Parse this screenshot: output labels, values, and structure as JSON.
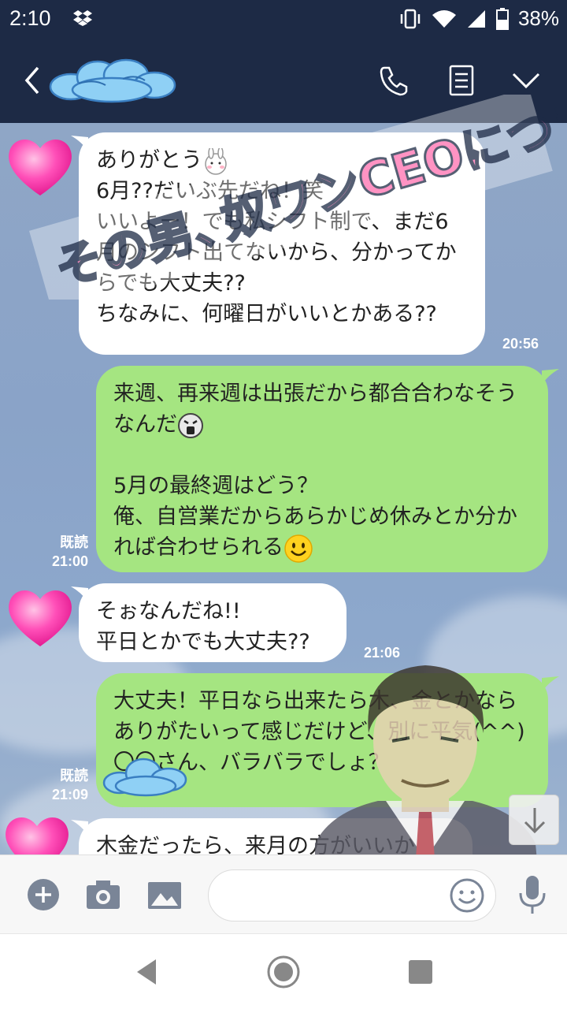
{
  "status_bar": {
    "time": "2:10",
    "battery": "38%"
  },
  "header": {
    "chat_name": "",
    "accent": "#1d2a45"
  },
  "messages": [
    {
      "id": "m1",
      "side": "in",
      "text_a": "ありがとう",
      "text_b": "6月??だいぶ先だね！笑\nいいよー！でも私シフト制で、まだ6月のシフト出てないから、分かってからでも大丈夫??\nちなみに、何曜日がいいとかある??",
      "time": "20:56"
    },
    {
      "id": "m2",
      "side": "out",
      "text_a": "来週、再来週は出張だから都合合わなそうなんだ",
      "text_b": "5月の最終週はどう？\n俺、自営業だからあらかじめ休みとか分かれば合わせられる",
      "read": "既読",
      "time": "21:00"
    },
    {
      "id": "m3",
      "side": "in",
      "text": "そぉなんだね!!\n平日とかでも大丈夫??",
      "time": "21:06"
    },
    {
      "id": "m4",
      "side": "out",
      "text": "大丈夫！平日なら出来たら木、金とかならありがたいって感じだけど、別に平気(^^)\n〇〇さん、バラバラでしょ？",
      "read": "既読",
      "time": "21:09"
    },
    {
      "id": "m5",
      "side": "in",
      "text": "木金だったら、来月の方がいいか"
    }
  ],
  "watermark": {
    "text": "その男、奴ワンCEOにつき。"
  },
  "input": {
    "placeholder": "",
    "value": ""
  },
  "colors": {
    "incoming": "#ffffff",
    "outgoing": "#a5e581",
    "chat_bg": "#8fa6c6"
  },
  "icons": [
    "back-icon",
    "call-icon",
    "notes-icon",
    "chevron-down-icon",
    "plus-icon",
    "camera-icon",
    "image-icon",
    "smile-icon",
    "mic-icon",
    "arrow-down-icon",
    "nav-back-icon",
    "nav-home-icon",
    "nav-recents-icon"
  ]
}
